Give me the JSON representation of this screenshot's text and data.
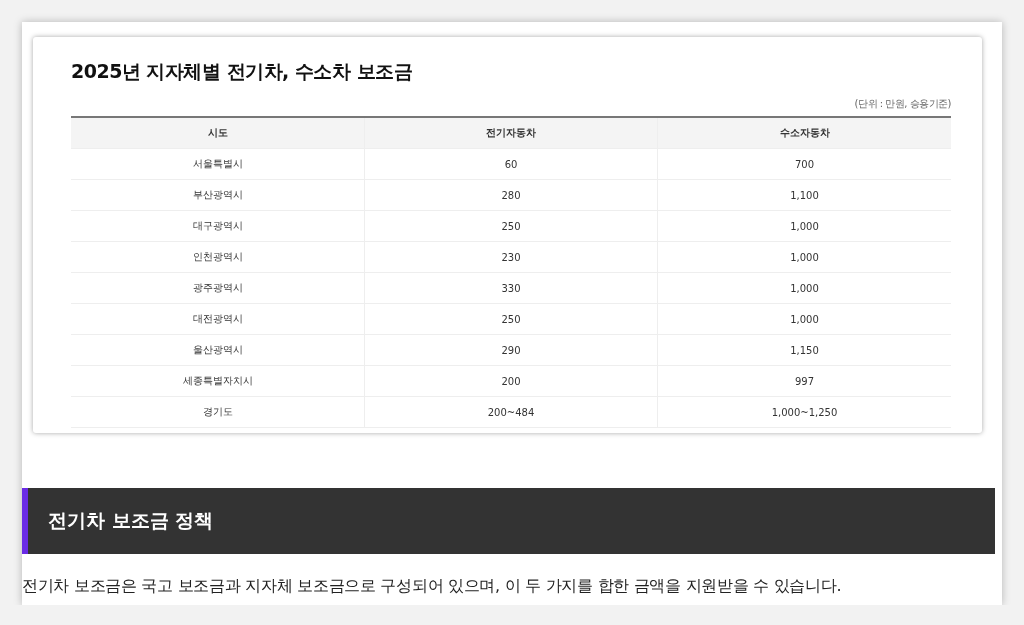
{
  "table_card": {
    "title": "2025년 지자체별 전기차, 수소차 보조금",
    "unit_note": "(단위 : 만원, 승용기준)",
    "columns": [
      "시도",
      "전기자동차",
      "수소자동차"
    ],
    "rows": [
      [
        "서울특별시",
        "60",
        "700"
      ],
      [
        "부산광역시",
        "280",
        "1,100"
      ],
      [
        "대구광역시",
        "250",
        "1,000"
      ],
      [
        "인천광역시",
        "230",
        "1,000"
      ],
      [
        "광주광역시",
        "330",
        "1,000"
      ],
      [
        "대전광역시",
        "250",
        "1,000"
      ],
      [
        "울산광역시",
        "290",
        "1,150"
      ],
      [
        "세종특별자치시",
        "200",
        "997"
      ],
      [
        "경기도",
        "200~484",
        "1,000~1,250"
      ]
    ]
  },
  "section": {
    "heading": "전기차 보조금 정책",
    "paragraph": "전기차 보조금은 국고 보조금과 지자체 보조금으로 구성되어 있으며, 이 두 가지를 합한 금액을 지원받을 수 있습니다."
  }
}
